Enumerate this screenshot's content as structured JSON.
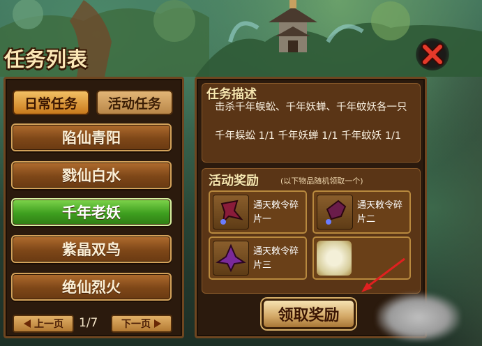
{
  "window": {
    "title": "任务列表"
  },
  "tabs": [
    {
      "label": "日常任务",
      "active": true
    },
    {
      "label": "活动任务",
      "active": false
    }
  ],
  "quests": [
    {
      "label": "陷仙青阳",
      "selected": false
    },
    {
      "label": "戮仙白水",
      "selected": false
    },
    {
      "label": "千年老妖",
      "selected": true
    },
    {
      "label": "紫晶双鸟",
      "selected": false
    },
    {
      "label": "绝仙烈火",
      "selected": false
    }
  ],
  "pagination": {
    "prev_label": "上一页",
    "next_label": "下一页",
    "page": "1/7"
  },
  "description": {
    "title": "任务描述",
    "text": "击杀千年蜈蚣、千年妖蝉、千年蚊妖各一只",
    "progress": "千年蜈蚣 1/1  千年妖蝉 1/1  千年蚊妖 1/1"
  },
  "rewards": {
    "title": "活动奖励",
    "note": "(以下物品随机领取一个)",
    "items": [
      {
        "name": "通天敕令碎片一",
        "icon": "shard-icon-1"
      },
      {
        "name": "通天敕令碎片二",
        "icon": "shard-icon-2"
      },
      {
        "name": "通天敕令碎片三",
        "icon": "shard-icon-3"
      }
    ],
    "claim_label": "领取奖励"
  },
  "colors": {
    "selected_quest": "#3e9f1f",
    "panel_border": "#6e4620",
    "close_red": "#e53a2a"
  }
}
